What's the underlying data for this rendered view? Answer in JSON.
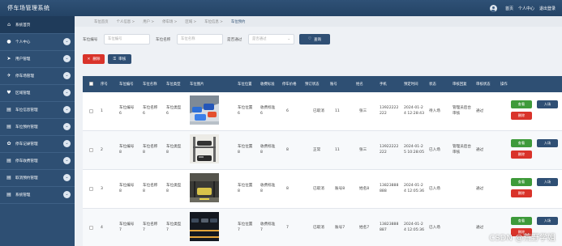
{
  "app": {
    "title": "停车场管理系统"
  },
  "topbar": {
    "home": "首页",
    "profile": "个人中心",
    "logout": "退出登录"
  },
  "sidebar": {
    "items": [
      {
        "label": "系统首页",
        "icon": "home-icon",
        "glyph": "⌂",
        "arrow": false
      },
      {
        "label": "个人中心",
        "icon": "user-icon",
        "glyph": "●",
        "arrow": true
      },
      {
        "label": "用户管理",
        "icon": "send-icon",
        "glyph": "➤",
        "arrow": true
      },
      {
        "label": "停车场管理",
        "icon": "car-icon",
        "glyph": "✈",
        "arrow": true
      },
      {
        "label": "区域管理",
        "icon": "tag-icon",
        "glyph": "♥",
        "arrow": true
      },
      {
        "label": "车位信息管理",
        "icon": "list-icon",
        "glyph": "▤",
        "arrow": true
      },
      {
        "label": "车位预约管理",
        "icon": "list-icon",
        "glyph": "▤",
        "arrow": true
      },
      {
        "label": "停车记录管理",
        "icon": "gear-icon",
        "glyph": "✿",
        "arrow": true
      },
      {
        "label": "停车收费管理",
        "icon": "list-icon",
        "glyph": "▤",
        "arrow": true
      },
      {
        "label": "取消预约管理",
        "icon": "list-icon",
        "glyph": "▤",
        "arrow": true
      },
      {
        "label": "系统管理",
        "icon": "list-icon",
        "glyph": "▤",
        "arrow": true
      }
    ]
  },
  "breadcrumb": [
    "车位首页",
    "个人信息 >",
    "用户 >",
    "停车场 >",
    "区域 >",
    "车位信息 >",
    "车位预约"
  ],
  "search": {
    "space_no_label": "车位编号",
    "space_no_placeholder": "车位编号",
    "space_name_label": "车位名称",
    "space_name_placeholder": "车位名称",
    "approved_label": "是否通过",
    "approved_value": "是否通过",
    "query_label": "查询"
  },
  "actions": {
    "delete_label": "删除",
    "review_label": "审核"
  },
  "table": {
    "headers": [
      "序号",
      "车位编号",
      "车位名称",
      "车位类型",
      "车位图片",
      "车位位置",
      "收费标准",
      "停车价格",
      "预订状态",
      "账号",
      "姓名",
      "手机",
      "预定时间",
      "状态",
      "审核回复",
      "审核状态",
      "操作"
    ],
    "rows": [
      {
        "index": "1",
        "space_no": "车位编号6",
        "space_name": "车位名称6",
        "space_type": "车位类型6",
        "image": "blue-cars",
        "location": "车位位置6",
        "fee": "收费标准6",
        "price": "6",
        "booking": "已取消",
        "account": "11",
        "name": "张三",
        "phone": "13922222222",
        "time": "2024-01-24 12:28:43",
        "status": "待入场",
        "reply": "管理员后台审核",
        "review": "通过",
        "view": "查看",
        "delete": "删除",
        "enter": "入场"
      },
      {
        "index": "2",
        "space_no": "车位编号8",
        "space_name": "车位名称8",
        "space_type": "车位类型8",
        "image": "stacker",
        "location": "车位位置8",
        "fee": "收费标准8",
        "price": "8",
        "booking": "正常",
        "account": "11",
        "name": "张三",
        "phone": "13922222222",
        "time": "2024-01-25 10:28:05",
        "status": "已入场",
        "reply": "管理员后台审核",
        "review": "通过",
        "view": "查看",
        "delete": "删除",
        "enter": "入场"
      },
      {
        "index": "3",
        "space_no": "车位编号8",
        "space_name": "车位名称8",
        "space_type": "车位类型8",
        "image": "garage",
        "location": "车位位置8",
        "fee": "收费标准8",
        "price": "8",
        "booking": "已取消",
        "account": "账号8",
        "name": "姓名8",
        "phone": "13823888888",
        "time": "2024-01-24 12:05:36",
        "status": "已入场",
        "reply": "",
        "review": "通过",
        "view": "查看",
        "delete": "删除",
        "enter": "入场"
      },
      {
        "index": "4",
        "space_no": "车位编号7",
        "space_name": "车位名称7",
        "space_type": "车位类型7",
        "image": "night-lot",
        "location": "车位位置7",
        "fee": "收费标准7",
        "price": "7",
        "booking": "已取消",
        "account": "账号7",
        "name": "姓名7",
        "phone": "13823888887",
        "time": "2024-01-24 12:05:36",
        "status": "已入场",
        "reply": "",
        "review": "通过",
        "view": "查看",
        "delete": "删除",
        "enter": "入场"
      }
    ]
  },
  "watermark": "CSDN @荒野学姐",
  "colors": {
    "navy": "#2e4f73",
    "red": "#d9332a",
    "green": "#3e9a3a"
  }
}
